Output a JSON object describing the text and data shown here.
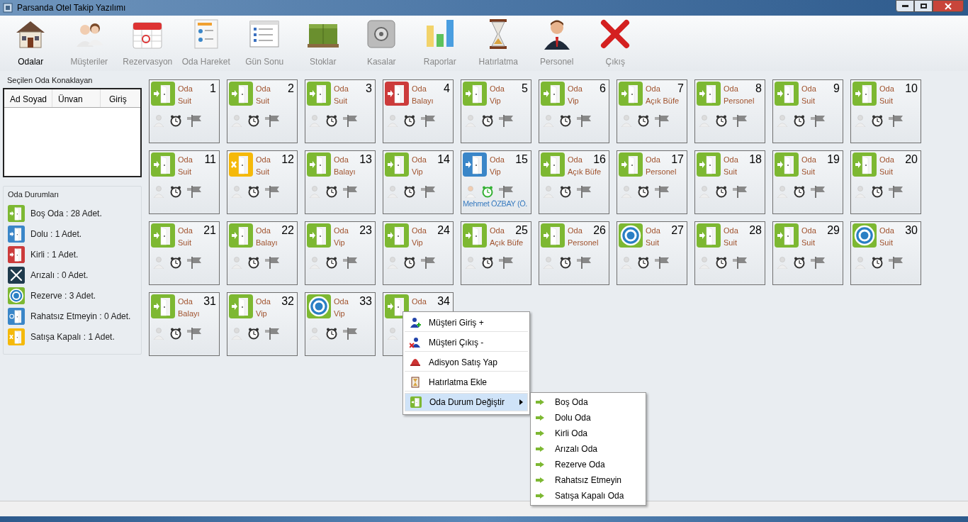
{
  "window": {
    "title": "Parsanda Otel Takip Yazılımı"
  },
  "toolbar": [
    {
      "label": "Odalar",
      "selected": true
    },
    {
      "label": "Müşteriler",
      "selected": false
    },
    {
      "label": "Rezervasyon",
      "selected": false
    },
    {
      "label": "Oda Hareket",
      "selected": false
    },
    {
      "label": "Gün Sonu",
      "selected": false
    },
    {
      "label": "Stoklar",
      "selected": false
    },
    {
      "label": "Kasalar",
      "selected": false
    },
    {
      "label": "Raporlar",
      "selected": false
    },
    {
      "label": "Hatırlatma",
      "selected": false
    },
    {
      "label": "Personel",
      "selected": false
    },
    {
      "label": "Çıkış",
      "selected": false
    }
  ],
  "guest_panel": {
    "title": "Seçilen Oda Konaklayan",
    "columns": [
      "Ad Soyad",
      "Ünvan",
      "Giriş"
    ]
  },
  "legend": {
    "title": "Oda Durumları",
    "items": [
      {
        "kind": "empty",
        "label": "Boş Oda : 28 Adet."
      },
      {
        "kind": "occupied",
        "label": "Dolu : 1 Adet."
      },
      {
        "kind": "dirty",
        "label": "Kirli : 1 Adet."
      },
      {
        "kind": "broken",
        "label": "Arızalı : 0 Adet."
      },
      {
        "kind": "reserved",
        "label": "Rezerve : 3 Adet."
      },
      {
        "kind": "dnd",
        "label": "Rahatsız Etmeyin : 0 Adet."
      },
      {
        "kind": "closed",
        "label": "Satışa Kapalı : 1 Adet."
      }
    ]
  },
  "rooms": [
    {
      "number": "1",
      "label": "Oda",
      "type": "Suit",
      "kind": "empty",
      "alarm_on": false
    },
    {
      "number": "2",
      "label": "Oda",
      "type": "Suit",
      "kind": "empty",
      "alarm_on": false
    },
    {
      "number": "3",
      "label": "Oda",
      "type": "Suit",
      "kind": "empty",
      "alarm_on": false
    },
    {
      "number": "4",
      "label": "Oda",
      "type": "Balayı",
      "kind": "dirty",
      "alarm_on": false
    },
    {
      "number": "5",
      "label": "Oda",
      "type": "Vip",
      "kind": "empty",
      "alarm_on": false
    },
    {
      "number": "6",
      "label": "Oda",
      "type": "Vip",
      "kind": "empty",
      "alarm_on": false
    },
    {
      "number": "7",
      "label": "Oda",
      "type": "Açık Büfe",
      "kind": "empty",
      "alarm_on": false
    },
    {
      "number": "8",
      "label": "Oda",
      "type": "Personel",
      "kind": "empty",
      "alarm_on": false
    },
    {
      "number": "9",
      "label": "Oda",
      "type": "Suit",
      "kind": "empty",
      "alarm_on": false
    },
    {
      "number": "10",
      "label": "Oda",
      "type": "Suit",
      "kind": "empty",
      "alarm_on": false
    },
    {
      "number": "11",
      "label": "Oda",
      "type": "Suit",
      "kind": "empty",
      "alarm_on": false
    },
    {
      "number": "12",
      "label": "Oda",
      "type": "Suit",
      "kind": "closed",
      "alarm_on": false
    },
    {
      "number": "13",
      "label": "Oda",
      "type": "Balayı",
      "kind": "empty",
      "alarm_on": false
    },
    {
      "number": "14",
      "label": "Oda",
      "type": "Vip",
      "kind": "empty",
      "alarm_on": false
    },
    {
      "number": "15",
      "label": "Oda",
      "type": "Vip",
      "kind": "occupied",
      "alarm_on": true,
      "guest": "Mehmet ÖZBAY (Ö."
    },
    {
      "number": "16",
      "label": "Oda",
      "type": "Açık Büfe",
      "kind": "empty",
      "alarm_on": false
    },
    {
      "number": "17",
      "label": "Oda",
      "type": "Personel",
      "kind": "empty",
      "alarm_on": false
    },
    {
      "number": "18",
      "label": "Oda",
      "type": "Suit",
      "kind": "empty",
      "alarm_on": false
    },
    {
      "number": "19",
      "label": "Oda",
      "type": "Suit",
      "kind": "empty",
      "alarm_on": false
    },
    {
      "number": "20",
      "label": "Oda",
      "type": "Suit",
      "kind": "empty",
      "alarm_on": false
    },
    {
      "number": "21",
      "label": "Oda",
      "type": "Suit",
      "kind": "empty",
      "alarm_on": false
    },
    {
      "number": "22",
      "label": "Oda",
      "type": "Balayı",
      "kind": "empty",
      "alarm_on": false
    },
    {
      "number": "23",
      "label": "Oda",
      "type": "Vip",
      "kind": "empty",
      "alarm_on": false
    },
    {
      "number": "24",
      "label": "Oda",
      "type": "Vip",
      "kind": "empty",
      "alarm_on": false
    },
    {
      "number": "25",
      "label": "Oda",
      "type": "Açık Büfe",
      "kind": "empty",
      "alarm_on": false
    },
    {
      "number": "26",
      "label": "Oda",
      "type": "Personel",
      "kind": "empty",
      "alarm_on": false
    },
    {
      "number": "27",
      "label": "Oda",
      "type": "Suit",
      "kind": "reserved",
      "alarm_on": false
    },
    {
      "number": "28",
      "label": "Oda",
      "type": "Suit",
      "kind": "empty",
      "alarm_on": false
    },
    {
      "number": "29",
      "label": "Oda",
      "type": "Suit",
      "kind": "empty",
      "alarm_on": false
    },
    {
      "number": "30",
      "label": "Oda",
      "type": "Suit",
      "kind": "reserved",
      "alarm_on": false
    },
    {
      "number": "31",
      "label": "Oda",
      "type": "Balayı",
      "kind": "empty",
      "alarm_on": false
    },
    {
      "number": "32",
      "label": "Oda",
      "type": "Vip",
      "kind": "empty",
      "alarm_on": false
    },
    {
      "number": "33",
      "label": "Oda",
      "type": "Vip",
      "kind": "reserved",
      "alarm_on": false
    },
    {
      "number": "34",
      "label": "Oda",
      "kind": "empty"
    }
  ],
  "context_menu": {
    "items": [
      {
        "kind": "checkin",
        "label": "Müşteri Giriş +",
        "selected": false,
        "has_submenu": false
      },
      {
        "kind": "checkout",
        "label": "Müşteri Çıkış -",
        "selected": false,
        "has_submenu": false
      },
      {
        "kind": "sale",
        "label": "Adisyon Satış Yap",
        "selected": false,
        "has_submenu": false
      },
      {
        "kind": "reminder",
        "label": "Hatırlatma Ekle",
        "selected": false,
        "has_submenu": false
      },
      {
        "kind": "status",
        "label": "Oda Durum Değiştir",
        "selected": true,
        "has_submenu": true
      }
    ],
    "submenu": [
      "Boş Oda",
      "Dolu Oda",
      "Kirli Oda",
      "Arızalı Oda",
      "Rezerve Oda",
      "Rahatsız Etmeyin",
      "Satışa Kapalı Oda"
    ]
  }
}
